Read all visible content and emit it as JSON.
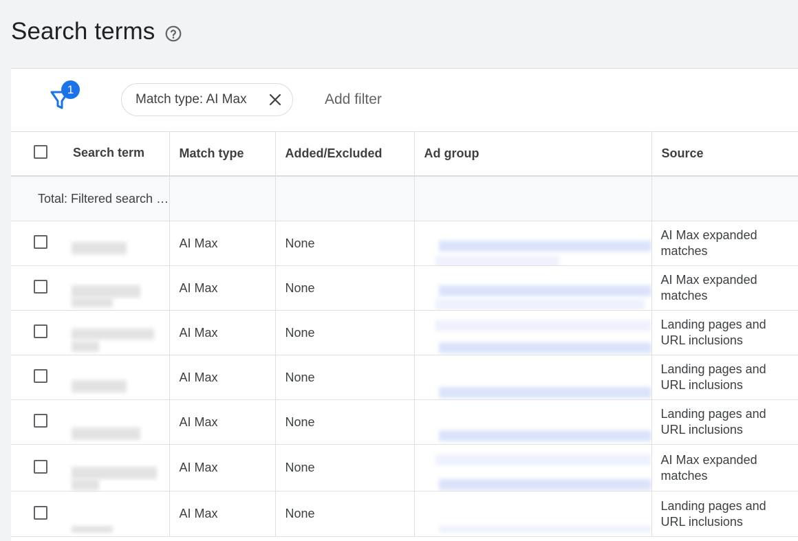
{
  "page": {
    "title": "Search terms",
    "help_icon": "help-circle-icon"
  },
  "filterbar": {
    "filter_icon": "filter-funnel-icon",
    "badge_count": "1",
    "chip_label": "Match type: AI Max",
    "chip_close_icon": "close-icon",
    "add_filter": "Add filter"
  },
  "table": {
    "columns": [
      "Search term",
      "Match type",
      "Added/Excluded",
      "Ad group",
      "Source"
    ],
    "total_label": "Total: Filtered search …",
    "rows": [
      {
        "match_type": "AI Max",
        "added_excluded": "None",
        "source": [
          "AI Max expanded",
          "matches"
        ]
      },
      {
        "match_type": "AI Max",
        "added_excluded": "None",
        "source": [
          "AI Max expanded",
          "matches"
        ]
      },
      {
        "match_type": "AI Max",
        "added_excluded": "None",
        "source": [
          "Landing pages and",
          "URL inclusions"
        ]
      },
      {
        "match_type": "AI Max",
        "added_excluded": "None",
        "source": [
          "Landing pages and",
          "URL inclusions"
        ]
      },
      {
        "match_type": "AI Max",
        "added_excluded": "None",
        "source": [
          "Landing pages and",
          "URL inclusions"
        ]
      },
      {
        "match_type": "AI Max",
        "added_excluded": "None",
        "source": [
          "AI Max expanded",
          "matches"
        ]
      },
      {
        "match_type": "AI Max",
        "added_excluded": "None",
        "source": [
          "Landing pages and",
          "URL inclusions"
        ]
      }
    ]
  },
  "colors": {
    "accent": "#1a73e8",
    "background": "#f1f3f4"
  }
}
